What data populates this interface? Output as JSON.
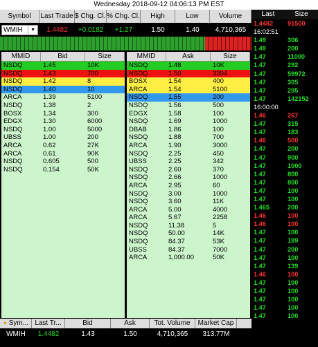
{
  "window_title": "Wednesday 2018-09-12 04:06:13 PM EST",
  "quote_header": [
    "Symbol",
    "Last Trade",
    "$ Chg. Cl...",
    "% Chg. Cl...",
    "High",
    "Low",
    "Volume"
  ],
  "quote": {
    "symbol": "WMIH",
    "last_trade": "1.4482",
    "chg": "+0.0182",
    "pct_chg": "+1.27",
    "high": "1.50",
    "low": "1.40",
    "volume": "4,710,365"
  },
  "bid_book": {
    "headers": [
      "MMID",
      "Bid",
      "Size"
    ],
    "rows": [
      [
        "NSDQ",
        "1.45",
        "10K",
        "#22cc22"
      ],
      [
        "NSDQ",
        "1.43",
        "700",
        "#ee1111"
      ],
      [
        "NSDQ",
        "1.42",
        "8",
        "#ffee44"
      ],
      [
        "NSDQ",
        "1.40",
        "10",
        "#3399ee"
      ],
      [
        "ARCA",
        "1.39",
        "5100",
        ""
      ],
      [
        "NSDQ",
        "1.38",
        "2",
        ""
      ],
      [
        "BOSX",
        "1.34",
        "300",
        ""
      ],
      [
        "EDGX",
        "1.30",
        "6000",
        ""
      ],
      [
        "NSDQ",
        "1.00",
        "5000",
        ""
      ],
      [
        "UBSS",
        "1.00",
        "200",
        ""
      ],
      [
        "ARCA",
        "0.62",
        "27K",
        ""
      ],
      [
        "ARCA",
        "0.61",
        "90K",
        ""
      ],
      [
        "NSDQ",
        "0.605",
        "500",
        ""
      ],
      [
        "NSDQ",
        "0.154",
        "50K",
        ""
      ]
    ]
  },
  "ask_book": {
    "headers": [
      "MMID",
      "Ask",
      "Size"
    ],
    "rows": [
      [
        "NSDQ",
        "1.48",
        "10K",
        "#22cc22"
      ],
      [
        "NSDQ",
        "1.50",
        "3394",
        "#ee1111"
      ],
      [
        "BOSX",
        "1.54",
        "400",
        "#ffee44"
      ],
      [
        "ARCA",
        "1.54",
        "5100",
        "#ffee44"
      ],
      [
        "NSDQ",
        "1.55",
        "200",
        "#3399ee"
      ],
      [
        "NSDQ",
        "1.56",
        "500",
        ""
      ],
      [
        "EDGX",
        "1.58",
        "100",
        ""
      ],
      [
        "NSDQ",
        "1.69",
        "1000",
        ""
      ],
      [
        "DBAB",
        "1.86",
        "100",
        ""
      ],
      [
        "NSDQ",
        "1.88",
        "700",
        ""
      ],
      [
        "ARCA",
        "1.90",
        "3000",
        ""
      ],
      [
        "NSDQ",
        "2.25",
        "450",
        ""
      ],
      [
        "UBSS",
        "2.25",
        "342",
        ""
      ],
      [
        "NSDQ",
        "2.60",
        "370",
        ""
      ],
      [
        "NSDQ",
        "2.66",
        "1000",
        ""
      ],
      [
        "ARCA",
        "2.95",
        "60",
        ""
      ],
      [
        "NSDQ",
        "3.00",
        "1000",
        ""
      ],
      [
        "NSDQ",
        "3.60",
        "11K",
        ""
      ],
      [
        "ARCA",
        "5.00",
        "4000",
        ""
      ],
      [
        "ARCA",
        "5.67",
        "2258",
        ""
      ],
      [
        "NSDQ",
        "11.38",
        "5",
        ""
      ],
      [
        "NSDQ",
        "50.00",
        "14K",
        ""
      ],
      [
        "NSDQ",
        "84.37",
        "53K",
        ""
      ],
      [
        "UBSS",
        "84.37",
        "7000",
        ""
      ],
      [
        "ARCA",
        "1,000.00",
        "50K",
        ""
      ]
    ]
  },
  "time_sales": {
    "headers": [
      "Last",
      "Size"
    ],
    "rows": [
      [
        "1.4482",
        "91500",
        "#ff3333"
      ],
      [
        "16:02:51",
        "",
        "time"
      ],
      [
        "1.49",
        "306",
        "#22dd22"
      ],
      [
        "1.49",
        "200",
        "#22dd22"
      ],
      [
        "1.47",
        "11000",
        "#22dd22"
      ],
      [
        "1.47",
        "292",
        "#22dd22"
      ],
      [
        "1.47",
        "59972",
        "#22dd22"
      ],
      [
        "1.47",
        "305",
        "#22dd22"
      ],
      [
        "1.47",
        "295",
        "#22dd22"
      ],
      [
        "1.47",
        "142152",
        "#22dd22"
      ],
      [
        "16:00:00",
        "",
        "time"
      ],
      [
        "1.46",
        "267",
        "#ff3333"
      ],
      [
        "1.47",
        "315",
        "#22dd22"
      ],
      [
        "1.47",
        "183",
        "#22dd22"
      ],
      [
        "1.46",
        "500",
        "#ff3333"
      ],
      [
        "1.47",
        "200",
        "#22dd22"
      ],
      [
        "1.47",
        "900",
        "#22dd22"
      ],
      [
        "1.47",
        "1000",
        "#22dd22"
      ],
      [
        "1.47",
        "800",
        "#22dd22"
      ],
      [
        "1.47",
        "800",
        "#22dd22"
      ],
      [
        "1.47",
        "100",
        "#22dd22"
      ],
      [
        "1.47",
        "100",
        "#22dd22"
      ],
      [
        "1.465",
        "200",
        "#22dd22"
      ],
      [
        "1.46",
        "100",
        "#ff3333"
      ],
      [
        "1.46",
        "100",
        "#ff3333"
      ],
      [
        "1.47",
        "100",
        "#22dd22"
      ],
      [
        "1.47",
        "189",
        "#22dd22"
      ],
      [
        "1.47",
        "200",
        "#22dd22"
      ],
      [
        "1.47",
        "100",
        "#22dd22"
      ],
      [
        "1.47",
        "139",
        "#22dd22"
      ],
      [
        "1.46",
        "100",
        "#ff3333"
      ],
      [
        "1.47",
        "100",
        "#22dd22"
      ],
      [
        "1.47",
        "100",
        "#22dd22"
      ],
      [
        "1.47",
        "100",
        "#22dd22"
      ],
      [
        "1.47",
        "100",
        "#22dd22"
      ],
      [
        "1.47",
        "100",
        "#22dd22"
      ]
    ]
  },
  "footer": {
    "headers": [
      "Sym...",
      "Last Tr...",
      "Bid",
      "Ask",
      "Tot. Volume",
      "Market Cap"
    ],
    "values": [
      "WMIH",
      "1.4482",
      "1.43",
      "1.50",
      "4,710,365",
      "313.77M"
    ]
  },
  "colors": {
    "up": "#22dd22",
    "down": "#ff3333",
    "book_bg": "#ccf5cc"
  }
}
